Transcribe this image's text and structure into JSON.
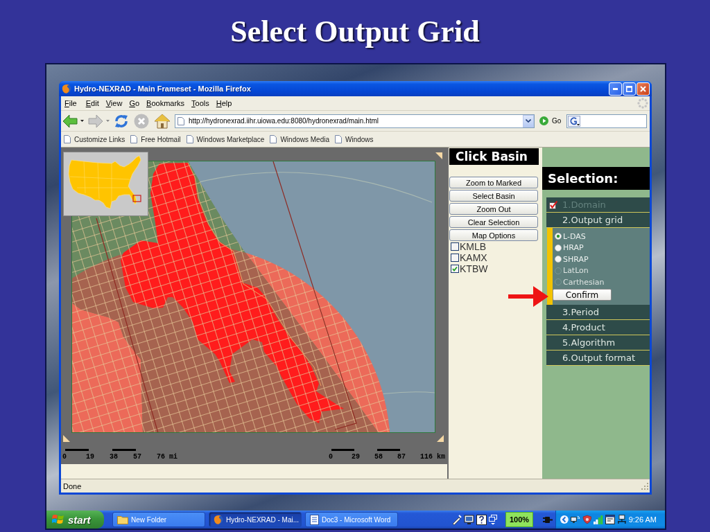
{
  "slide": {
    "title": "Select Output Grid"
  },
  "window": {
    "title": "Hydro-NEXRAD - Main Frameset - Mozilla Firefox"
  },
  "menu": [
    "File",
    "Edit",
    "View",
    "Go",
    "Bookmarks",
    "Tools",
    "Help"
  ],
  "toolbar": {
    "address": "http://hydronexrad.iihr.uiowa.edu:8080/hydronexrad/main.html",
    "go_label": "Go"
  },
  "bookmarks": [
    "Customize Links",
    "Free Hotmail",
    "Windows Marketplace",
    "Windows Media",
    "Windows"
  ],
  "map": {
    "scale_miles": [
      "0",
      "19",
      "38",
      "57",
      "76 mi"
    ],
    "scale_km": [
      "0",
      "29",
      "58",
      "87",
      "116 km"
    ]
  },
  "basin_panel": {
    "title": "Click Basin",
    "buttons": [
      "Zoom to Marked",
      "Select Basin",
      "Zoom Out",
      "Clear Selection",
      "Map Options"
    ],
    "radars": [
      {
        "label": "KMLB",
        "checked": false
      },
      {
        "label": "KAMX",
        "checked": false
      },
      {
        "label": "KTBW",
        "checked": true
      }
    ]
  },
  "selection_panel": {
    "title": "Selection:",
    "steps": [
      {
        "label": "1.Domain",
        "done": true
      },
      {
        "label": "2.Output grid",
        "done": false,
        "options": [
          {
            "label": "L-DAS",
            "selected": true,
            "disabled": false
          },
          {
            "label": "HRAP",
            "selected": false,
            "disabled": false
          },
          {
            "label": "SHRAP",
            "selected": false,
            "disabled": false
          },
          {
            "label": "LatLon",
            "selected": false,
            "disabled": true
          },
          {
            "label": "Carthesian",
            "selected": false,
            "disabled": true
          }
        ],
        "confirm_label": "Confirm"
      },
      {
        "label": "3.Period",
        "done": false
      },
      {
        "label": "4.Product",
        "done": false
      },
      {
        "label": "5.Algorithm",
        "done": false
      },
      {
        "label": "6.Output format",
        "done": false
      }
    ]
  },
  "status_bar": {
    "text": "Done"
  },
  "taskbar": {
    "start_label": "start",
    "tasks": [
      {
        "label": "New Folder",
        "selected": false,
        "kind": "folder"
      },
      {
        "label": "Hydro-NEXRAD - Mai...",
        "selected": true,
        "kind": "browser"
      },
      {
        "label": "Doc3 - Microsoft Word",
        "selected": false,
        "kind": "document"
      }
    ],
    "indicator": "100%",
    "clock": "9:26 AM"
  }
}
